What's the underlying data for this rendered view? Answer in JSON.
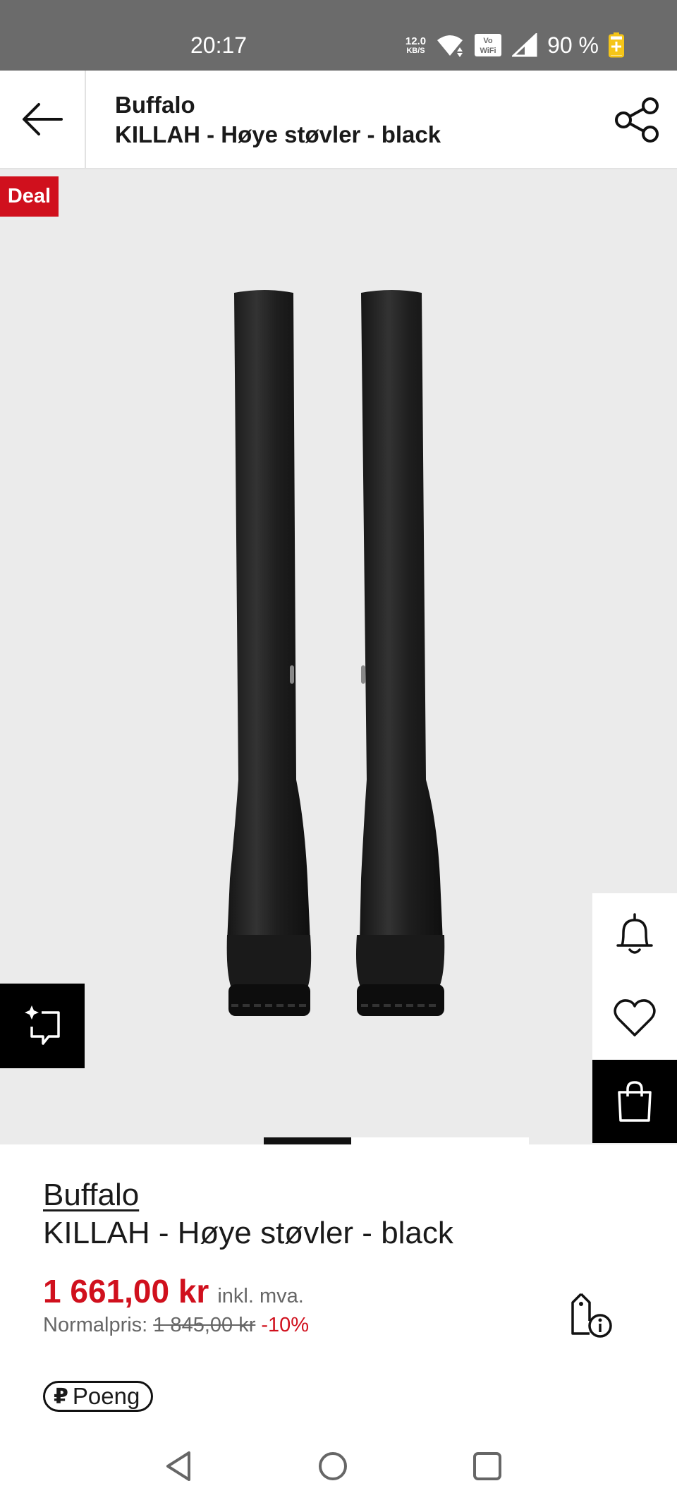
{
  "status_bar": {
    "time": "20:17",
    "net_speed_value": "12.0",
    "net_speed_unit": "KB/S",
    "battery": "90 %",
    "icons": [
      "wifi-icon",
      "vowifi-icon",
      "signal-icon",
      "battery-charging-icon"
    ]
  },
  "header": {
    "brand": "Buffalo",
    "title": "KILLAH - Høye støvler - black",
    "back_icon": "arrow-left-icon",
    "share_icon": "share-icon"
  },
  "image": {
    "badge": "Deal",
    "pager_pages": 3,
    "pager_active_index": 0,
    "ai_button_icon": "sparkle-crop-icon",
    "side_actions": [
      "bell-icon",
      "heart-icon",
      "shopping-bag-icon"
    ]
  },
  "product": {
    "brand": "Buffalo",
    "name": "KILLAH - Høye støvler - black",
    "price": "1 661,00 kr",
    "vat_note": "inkl. mva.",
    "normal_label": "Normalpris:",
    "normal_price": "1 845,00 kr",
    "discount": "-10%",
    "points_glyph": "₽",
    "points_label": "Poeng",
    "price_info_icon": "price-tag-info-icon"
  },
  "colors": {
    "accent_red": "#d0101d",
    "status_bar": "#6b6b6b",
    "image_background": "#ebebeb"
  },
  "nav_bar": {
    "icons": [
      "nav-back-icon",
      "nav-home-icon",
      "nav-recents-icon"
    ]
  }
}
